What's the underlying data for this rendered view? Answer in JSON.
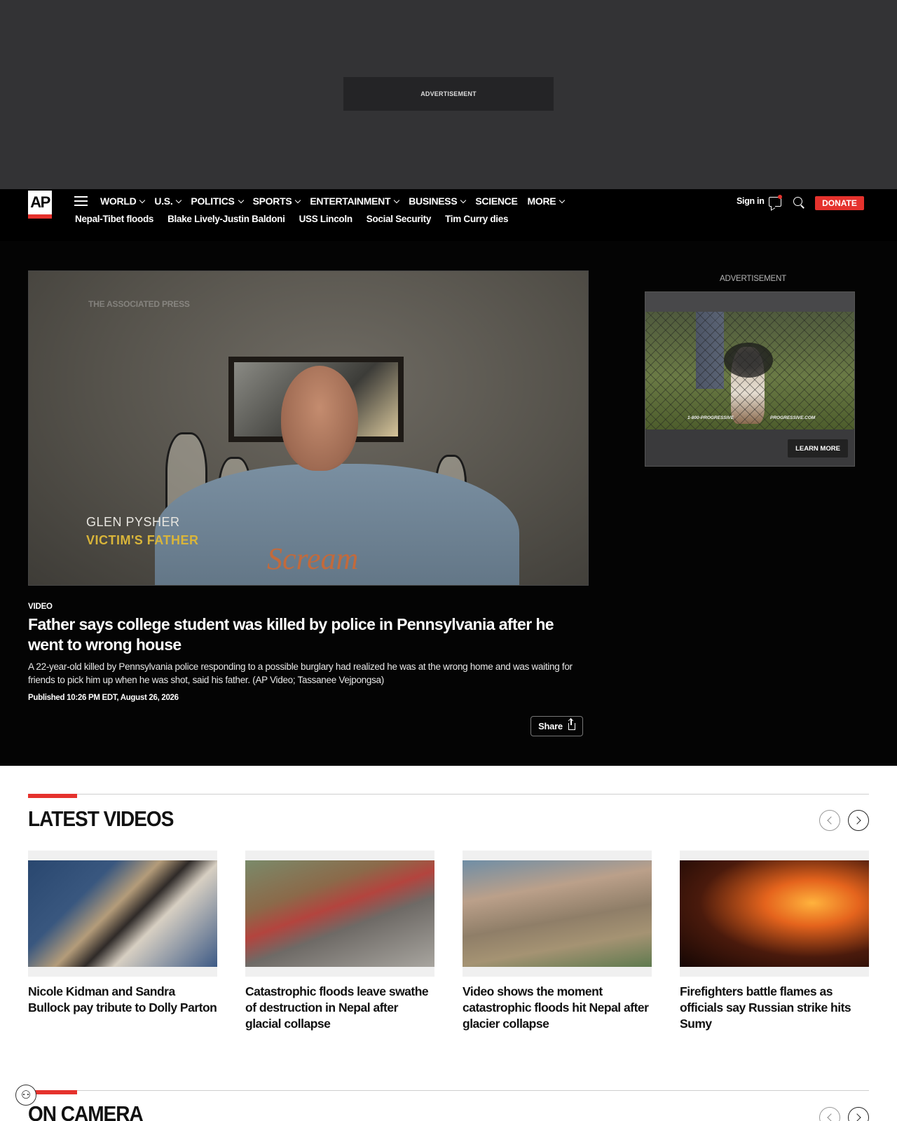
{
  "ad_band": {
    "label": "ADVERTISEMENT"
  },
  "header": {
    "logo_text": "AP",
    "nav": [
      {
        "label": "WORLD",
        "has_menu": true
      },
      {
        "label": "U.S.",
        "has_menu": true
      },
      {
        "label": "POLITICS",
        "has_menu": true
      },
      {
        "label": "SPORTS",
        "has_menu": true
      },
      {
        "label": "ENTERTAINMENT",
        "has_menu": true
      },
      {
        "label": "BUSINESS",
        "has_menu": true
      },
      {
        "label": "SCIENCE",
        "has_menu": false
      },
      {
        "label": "MORE",
        "has_menu": true
      }
    ],
    "trending": [
      "Nepal-Tibet floods",
      "Blake Lively-Justin Baldoni",
      "USS Lincoln",
      "Social Security",
      "Tim Curry dies"
    ],
    "sign_in": "Sign in",
    "donate": "DONATE"
  },
  "hero": {
    "video": {
      "watermark": "THE ASSOCIATED PRESS",
      "lower_third_name": "GLEN PYSHER",
      "lower_third_role": "VICTIM'S FATHER",
      "shirt_text": "Scream"
    },
    "kicker": "VIDEO",
    "headline": "Father says college student was killed by police in Pennsylvania after he went to wrong house",
    "summary": "A 22-year-old killed by Pennsylvania police responding to a possible burglary had realized he was at the wrong home and was waiting for friends to pick him up when he was shot, said his father. (AP Video; Tassanee Vejpongsa)",
    "published": "Published 10:26 PM EDT, August 26, 2026",
    "share_label": "Share"
  },
  "side_ad": {
    "label": "ADVERTISEMENT",
    "phone": "1-800-PROGRESSIVE",
    "site": "PROGRESSIVE.COM",
    "cta": "LEARN MORE"
  },
  "latest_videos": {
    "title": "LATEST VIDEOS",
    "items": [
      {
        "title": "Nicole Kidman and Sandra Bullock pay tribute to Dolly Parton"
      },
      {
        "title": "Catastrophic floods leave swathe of destruction in Nepal after glacial collapse"
      },
      {
        "title": "Video shows the moment catastrophic floods hit Nepal after glacier collapse"
      },
      {
        "title": "Firefighters battle flames as officials say Russian strike hits Sumy"
      }
    ]
  },
  "on_camera": {
    "title": "ON CAMERA"
  },
  "colors": {
    "accent": "#e5322d",
    "header_bg": "#000000",
    "ad_bg": "#333335"
  }
}
